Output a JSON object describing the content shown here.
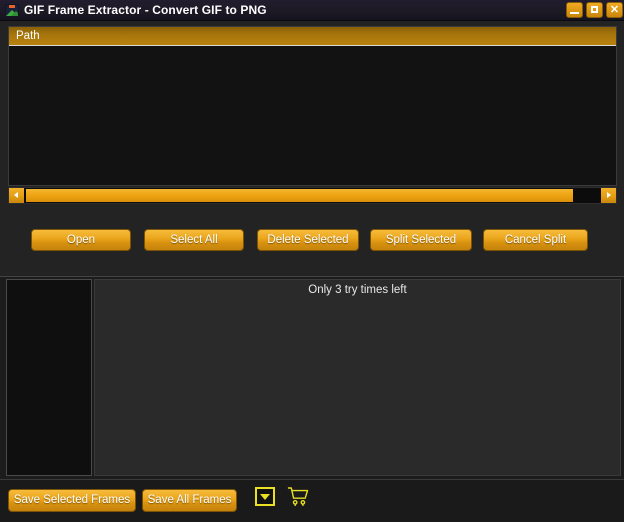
{
  "window": {
    "title": "GIF Frame Extractor - Convert GIF to PNG",
    "app_icon": "image-picture-icon",
    "controls": {
      "minimize_label": "_",
      "maximize_label": "□",
      "close_label": "✕"
    },
    "accent_color": "#eba61c",
    "header_color": "#a8760c",
    "highlight_color": "#e8e020",
    "background_color": "#232323"
  },
  "file_list": {
    "columns": [
      "Path"
    ],
    "rows": [],
    "scrollbar": {
      "left_arrow": "scroll-left-arrow",
      "right_arrow": "scroll-right-arrow",
      "thumb_position_percent": 0,
      "thumb_width_percent": 92
    }
  },
  "toolbar": {
    "open_label": "Open",
    "select_all_label": "Select All",
    "delete_selected_label": "Delete Selected",
    "split_selected_label": "Split Selected",
    "cancel_split_label": "Cancel Split"
  },
  "preview": {
    "status_text": "Only 3 try times left",
    "thumbnails": []
  },
  "bottom_bar": {
    "save_selected_label": "Save Selected Frames",
    "save_all_label": "Save All Frames",
    "dropdown_icon": "chevron-down-icon",
    "cart_icon": "shopping-cart-icon"
  }
}
